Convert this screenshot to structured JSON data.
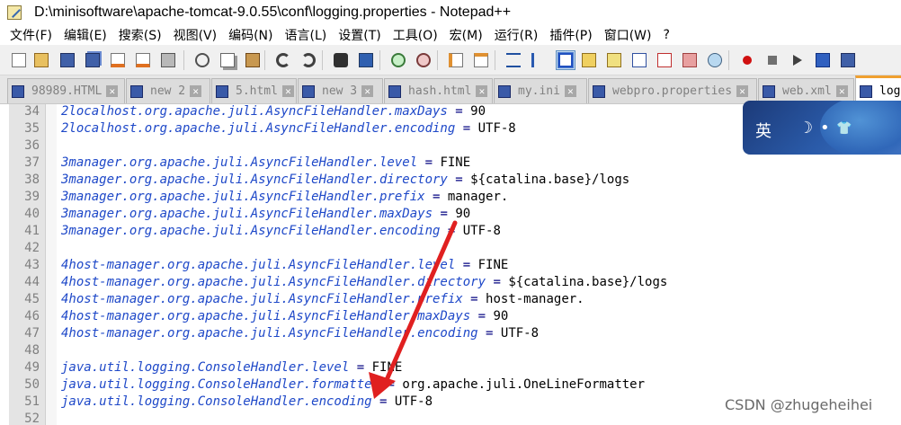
{
  "window": {
    "title": "D:\\minisoftware\\apache-tomcat-9.0.55\\conf\\logging.properties - Notepad++"
  },
  "menu": [
    "文件(F)",
    "编辑(E)",
    "搜索(S)",
    "视图(V)",
    "编码(N)",
    "语言(L)",
    "设置(T)",
    "工具(O)",
    "宏(M)",
    "运行(R)",
    "插件(P)",
    "窗口(W)",
    "?"
  ],
  "toolbar_icons": [
    "new-file-icon",
    "open-file-icon",
    "save-icon",
    "save-all-icon",
    "close-icon",
    "close-all-icon",
    "print-icon",
    "cut-icon",
    "copy-icon",
    "paste-icon",
    "undo-icon",
    "redo-icon",
    "find-icon",
    "replace-icon",
    "zoom-in-icon",
    "zoom-out-icon",
    "sync-vertical-icon",
    "sync-horizontal-icon",
    "word-wrap-icon",
    "show-all-chars-icon",
    "indent-guide-icon",
    "udl-icon",
    "doc-map-icon",
    "doc-list-icon",
    "function-list-icon",
    "folder-workspace-icon",
    "monitoring-icon",
    "record-macro-icon",
    "stop-macro-icon",
    "play-macro-icon",
    "run-macro-multiple-icon",
    "save-macro-icon"
  ],
  "tabs": [
    {
      "label": "98989.HTML",
      "active": false
    },
    {
      "label": "new 2",
      "active": false
    },
    {
      "label": "5.html",
      "active": false
    },
    {
      "label": "new 3",
      "active": false
    },
    {
      "label": "hash.html",
      "active": false
    },
    {
      "label": "my.ini",
      "active": false
    },
    {
      "label": "webpro.properties",
      "active": false
    },
    {
      "label": "web.xml",
      "active": false
    },
    {
      "label": "log",
      "active": true
    }
  ],
  "editor": {
    "lines": [
      {
        "num": "34",
        "key": "2localhost.org.apache.juli.AsyncFileHandler.maxDays",
        "val": "90"
      },
      {
        "num": "35",
        "key": "2localhost.org.apache.juli.AsyncFileHandler.encoding",
        "val": "UTF-8"
      },
      {
        "num": "36",
        "key": "",
        "val": ""
      },
      {
        "num": "37",
        "key": "3manager.org.apache.juli.AsyncFileHandler.level",
        "val": "FINE"
      },
      {
        "num": "38",
        "key": "3manager.org.apache.juli.AsyncFileHandler.directory",
        "val": "${catalina.base}/logs"
      },
      {
        "num": "39",
        "key": "3manager.org.apache.juli.AsyncFileHandler.prefix",
        "val": "manager."
      },
      {
        "num": "40",
        "key": "3manager.org.apache.juli.AsyncFileHandler.maxDays",
        "val": "90"
      },
      {
        "num": "41",
        "key": "3manager.org.apache.juli.AsyncFileHandler.encoding",
        "val": "UTF-8"
      },
      {
        "num": "42",
        "key": "",
        "val": ""
      },
      {
        "num": "43",
        "key": "4host-manager.org.apache.juli.AsyncFileHandler.level",
        "val": "FINE"
      },
      {
        "num": "44",
        "key": "4host-manager.org.apache.juli.AsyncFileHandler.directory",
        "val": "${catalina.base}/logs"
      },
      {
        "num": "45",
        "key": "4host-manager.org.apache.juli.AsyncFileHandler.prefix",
        "val": "host-manager."
      },
      {
        "num": "46",
        "key": "4host-manager.org.apache.juli.AsyncFileHandler.maxDays",
        "val": "90"
      },
      {
        "num": "47",
        "key": "4host-manager.org.apache.juli.AsyncFileHandler.encoding",
        "val": "UTF-8"
      },
      {
        "num": "48",
        "key": "",
        "val": ""
      },
      {
        "num": "49",
        "key": "java.util.logging.ConsoleHandler.level",
        "val": "FINE"
      },
      {
        "num": "50",
        "key": "java.util.logging.ConsoleHandler.formatter",
        "val": "org.apache.juli.OneLineFormatter"
      },
      {
        "num": "51",
        "key": "java.util.logging.ConsoleHandler.encoding",
        "val": "UTF-8"
      },
      {
        "num": "52",
        "key": "",
        "val": ""
      }
    ]
  },
  "ime": {
    "glyphs": [
      "英",
      "☽",
      "•",
      "👕"
    ]
  },
  "watermark": "CSDN @zhugeheihei",
  "colors": {
    "key": "#1e48c8",
    "annotation_arrow": "#e02020",
    "active_tab_accent": "#f0a030"
  }
}
